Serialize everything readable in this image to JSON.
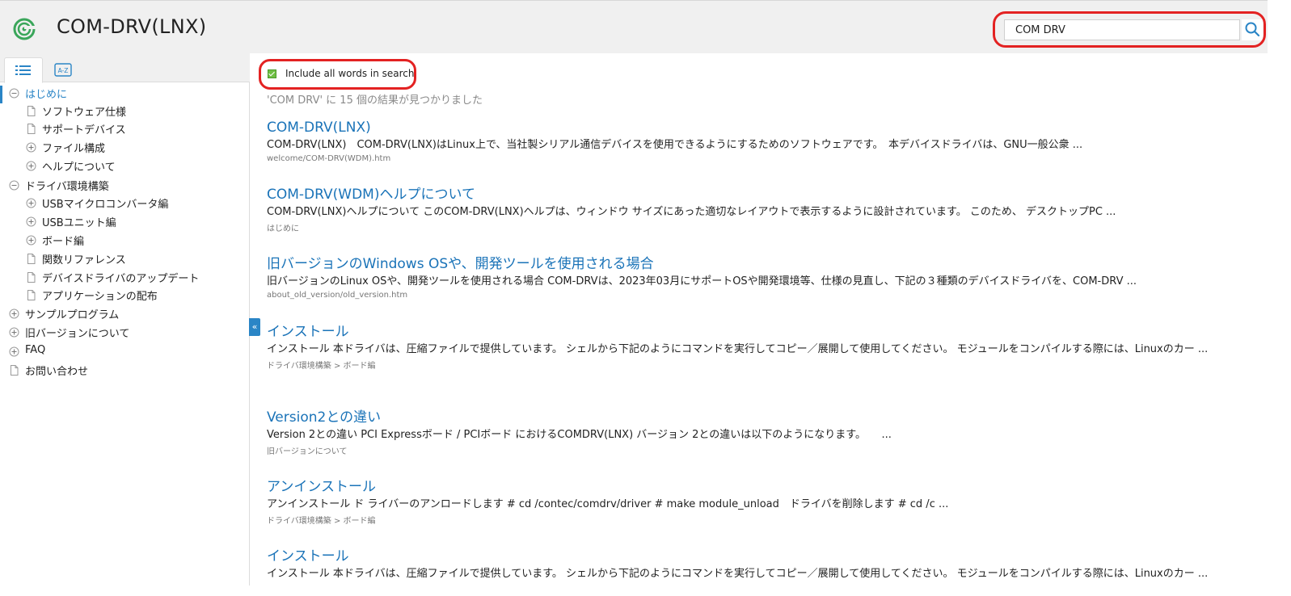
{
  "header": {
    "title": "COM-DRV(LNX)",
    "search_value": "COM DRV"
  },
  "sidebar": {
    "tabs": [
      {
        "icon": "list-icon",
        "label": "Contents"
      },
      {
        "icon": "az-index-icon",
        "label": "A-Z"
      }
    ],
    "tab_index_glyph": "A-Z",
    "tree": [
      {
        "label": "はじめに",
        "level": 0,
        "toggle": "collapse",
        "active": true
      },
      {
        "label": "ソフトウェア仕様",
        "level": 1,
        "toggle": "page"
      },
      {
        "label": "サポートデバイス",
        "level": 1,
        "toggle": "page"
      },
      {
        "label": "ファイル構成",
        "level": 1,
        "toggle": "expand"
      },
      {
        "label": "ヘルプについて",
        "level": 1,
        "toggle": "expand"
      },
      {
        "label": "ドライバ環境構築",
        "level": 0,
        "toggle": "collapse"
      },
      {
        "label": "USBマイクロコンバータ編",
        "level": 1,
        "toggle": "expand"
      },
      {
        "label": "USBユニット編",
        "level": 1,
        "toggle": "expand"
      },
      {
        "label": "ボード編",
        "level": 1,
        "toggle": "expand"
      },
      {
        "label": "関数リファレンス",
        "level": 1,
        "toggle": "page"
      },
      {
        "label": "デバイスドライバのアップデート",
        "level": 1,
        "toggle": "page"
      },
      {
        "label": "アプリケーションの配布",
        "level": 1,
        "toggle": "page"
      },
      {
        "label": "サンプルプログラム",
        "level": 0,
        "toggle": "expand"
      },
      {
        "label": "旧バージョンについて",
        "level": 0,
        "toggle": "expand"
      },
      {
        "label": "FAQ",
        "level": 0,
        "toggle": "expand"
      },
      {
        "label": "お問い合わせ",
        "level": 0,
        "toggle": "page"
      }
    ],
    "collapse_glyph": "«"
  },
  "main": {
    "include_all_words_label": "Include all words in search",
    "include_all_words_checked": true,
    "result_count_text": "'COM DRV' に 15 個の結果が見つかりました",
    "results": [
      {
        "title": "COM-DRV(LNX)",
        "snippet": "COM-DRV(LNX)　COM-DRV(LNX)はLinux上で、当社製シリアル通信デバイスを使用できるようにするためのソフトウェアです。　本デバイスドライバは、GNU一般公衆 ...",
        "path": "welcome/COM-DRV(WDM).htm"
      },
      {
        "title": "COM-DRV(WDM)ヘルプについて",
        "snippet": "COM-DRV(LNX)ヘルプについて このCOM-DRV(LNX)ヘルプは、ウィンドウ サイズにあった適切なレイアウトで表示するように設計されています。 このため、 デスクトップPC ...",
        "path": "はじめに"
      },
      {
        "title": "旧バージョンのWindows OSや、開発ツールを使用される場合",
        "snippet": "旧バージョンのLinux OSや、開発ツールを使用される場合 COM-DRVは、2023年03月にサポートOSや開発環境等、仕様の見直し、下記の３種類のデバイスドライバを、COM-DRV ...",
        "path": "about_old_version/old_version.htm"
      },
      {
        "title": "インストール",
        "snippet": "インストール 本ドライバは、圧縮ファイルで提供しています。 シェルから下記のようにコマンドを実行してコピー／展開して使用してください。 モジュールをコンパイルする際には、Linuxのカー ...",
        "path": "ドライバ環境構築 > ボード編"
      },
      {
        "title": "Version2との違い",
        "snippet": "Version 2との違い PCI Expressボード / PCIボード におけるCOMDRV(LNX) バージョン 2との違いは以下のようになります。　　...",
        "path": "旧バージョンについて"
      },
      {
        "title": "アンインストール",
        "snippet": "アンインストール ド ライバーのアンロードします # cd /contec/comdrv/driver # make module_unload　ドライバを削除します # cd /c ...",
        "path": "ドライバ環境構築 > ボード編"
      },
      {
        "title": "インストール",
        "snippet": "インストール 本ドライバは、圧縮ファイルで提供しています。 シェルから下記のようにコマンドを実行してコピー／展開して使用してください。 モジュールをコンパイルする際には、Linuxのカー ...",
        "path": ""
      }
    ]
  },
  "colors": {
    "accent": "#2a85c6",
    "link": "#1a73b8",
    "highlight_annotation": "#e32222",
    "checkbox": "#6fbe44"
  }
}
